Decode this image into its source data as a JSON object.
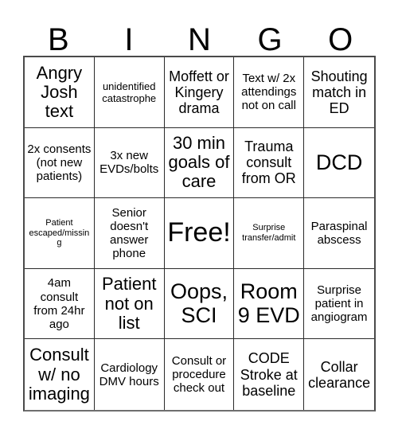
{
  "card": {
    "title": "BINGO",
    "header_letters": [
      "B",
      "I",
      "N",
      "G",
      "O"
    ],
    "colors": {
      "background": "#ffffff",
      "text": "#000000",
      "grid_line": "#2b2b2b",
      "grid_outer": "#4a4a4a"
    },
    "columns": 5,
    "rows": 5,
    "free_space_index": 12,
    "cells": [
      {
        "text": "Angry Josh text",
        "size": "xl"
      },
      {
        "text": "unidentified catastrophe",
        "size": "s"
      },
      {
        "text": "Moffett or Kingery drama",
        "size": "l"
      },
      {
        "text": "Text w/ 2x attendings not on call",
        "size": "m"
      },
      {
        "text": "Shouting match in ED",
        "size": "l"
      },
      {
        "text": "2x consents (not new patients)",
        "size": "m"
      },
      {
        "text": "3x new EVDs/bolts",
        "size": "m"
      },
      {
        "text": "30 min goals of care",
        "size": "xl"
      },
      {
        "text": "Trauma consult from OR",
        "size": "l"
      },
      {
        "text": "DCD",
        "size": "xxl"
      },
      {
        "text": "Patient escaped/missing",
        "size": "xs"
      },
      {
        "text": "Senior doesn't answer phone",
        "size": "m"
      },
      {
        "text": "Free!",
        "size": "free"
      },
      {
        "text": "Surprise transfer/admit",
        "size": "xs"
      },
      {
        "text": "Paraspinal abscess",
        "size": "m"
      },
      {
        "text": "4am consult from 24hr ago",
        "size": "m"
      },
      {
        "text": "Patient not on list",
        "size": "xl"
      },
      {
        "text": "Oops, SCI",
        "size": "xxl"
      },
      {
        "text": "Room 9 EVD",
        "size": "xxl"
      },
      {
        "text": "Surprise patient in angiogram",
        "size": "m"
      },
      {
        "text": "Consult w/ no imaging",
        "size": "xl"
      },
      {
        "text": "Cardiology DMV hours",
        "size": "m"
      },
      {
        "text": "Consult or procedure check out",
        "size": "m"
      },
      {
        "text": "CODE Stroke at baseline",
        "size": "l"
      },
      {
        "text": "Collar clearance",
        "size": "l"
      }
    ]
  }
}
